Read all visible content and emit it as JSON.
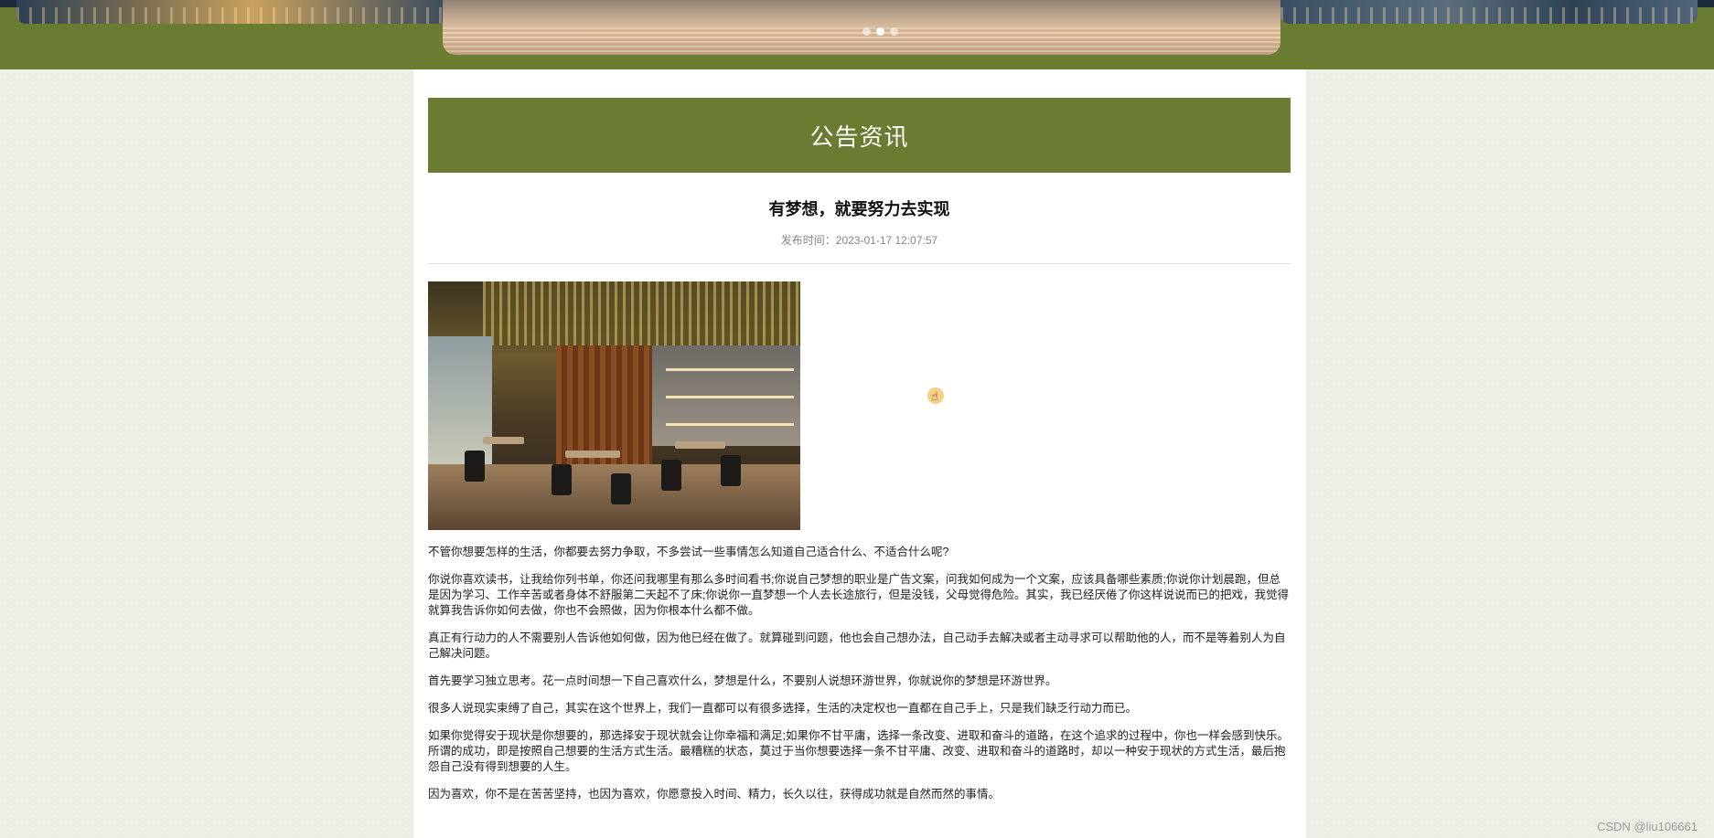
{
  "banner": {
    "slides": 3,
    "active_slide": 2
  },
  "section_header": "公告资讯",
  "article": {
    "title": "有梦想，就要努力去实现",
    "publish_label": "发布时间：",
    "publish_time": "2023-01-17 12:07:57",
    "paragraphs": [
      "不管你想要怎样的生活，你都要去努力争取，不多尝试一些事情怎么知道自己适合什么、不适合什么呢?",
      "你说你喜欢读书，让我给你列书单，你还问我哪里有那么多时间看书;你说自己梦想的职业是广告文案，问我如何成为一个文案，应该具备哪些素质;你说你计划晨跑，但总是因为学习、工作辛苦或者身体不舒服第二天起不了床;你说你一直梦想一个人去长途旅行，但是没钱，父母觉得危险。其实，我已经厌倦了你这样说说而已的把戏，我觉得就算我告诉你如何去做，你也不会照做，因为你根本什么都不做。",
      "真正有行动力的人不需要别人告诉他如何做，因为他已经在做了。就算碰到问题，他也会自己想办法，自己动手去解决或者主动寻求可以帮助他的人，而不是等着别人为自己解决问题。",
      "首先要学习独立思考。花一点时间想一下自己喜欢什么，梦想是什么，不要别人说想环游世界，你就说你的梦想是环游世界。",
      "很多人说现实束缚了自己，其实在这个世界上，我们一直都可以有很多选择，生活的决定权也一直都在自己手上，只是我们缺乏行动力而已。",
      "如果你觉得安于现状是你想要的，那选择安于现状就会让你幸福和满足;如果你不甘平庸，选择一条改变、进取和奋斗的道路，在这个追求的过程中，你也一样会感到快乐。所谓的成功，即是按照自己想要的生活方式生活。最糟糕的状态，莫过于当你想要选择一条不甘平庸、改变、进取和奋斗的道路时，却以一种安于现状的方式生活，最后抱怨自己没有得到想要的人生。",
      "因为喜欢，你不是在苦苦坚持，也因为喜欢，你愿意投入时间、精力，长久以往，获得成功就是自然而然的事情。"
    ]
  },
  "watermark": "CSDN @liu106661"
}
